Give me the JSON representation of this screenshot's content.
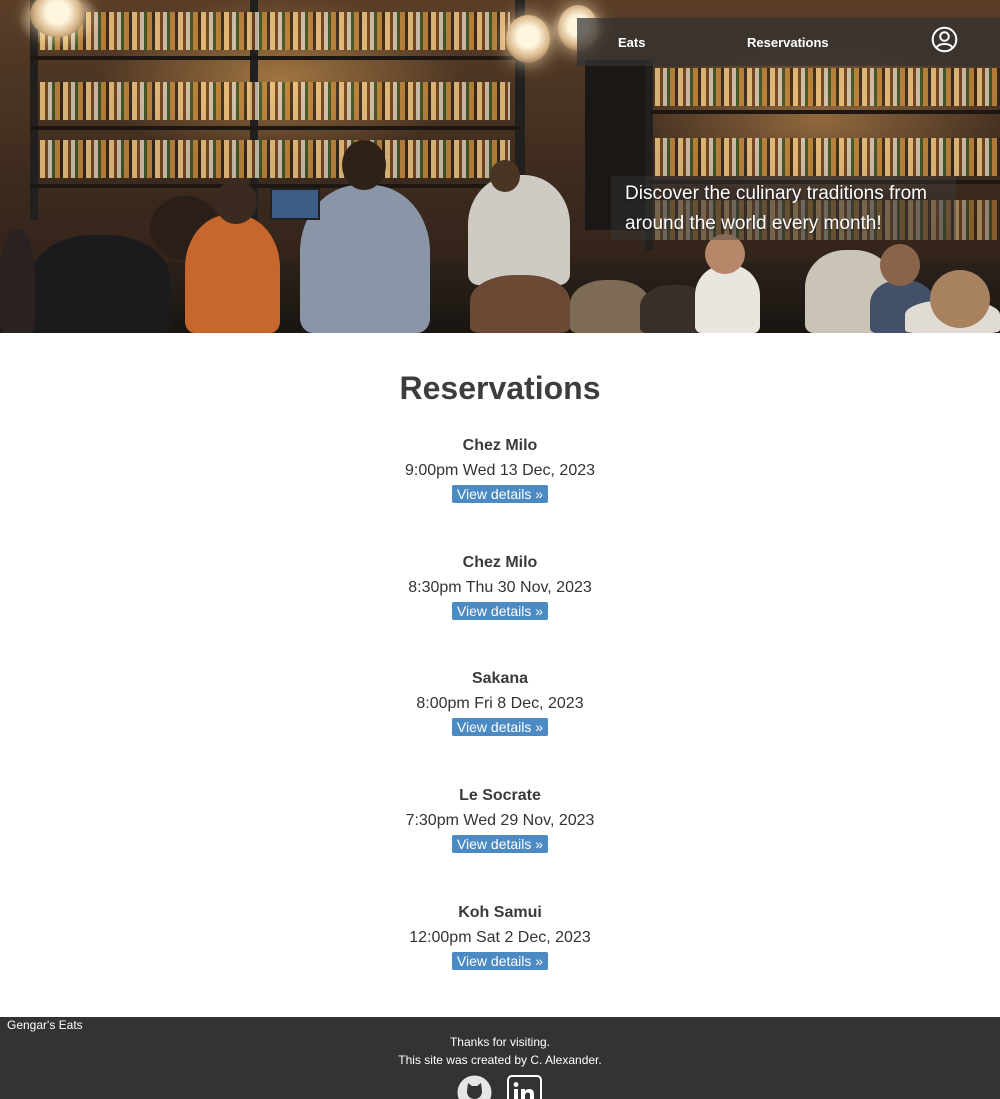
{
  "nav": {
    "items": [
      {
        "label": "Eats"
      },
      {
        "label": "Reservations"
      }
    ],
    "account_icon": "user-circle-icon"
  },
  "hero": {
    "tagline": "Discover the culinary traditions from around the world every month!"
  },
  "main": {
    "title": "Reservations",
    "reservations": [
      {
        "name": "Chez Milo",
        "datetime": "9:00pm Wed 13 Dec, 2023",
        "button": "View details »"
      },
      {
        "name": "Chez Milo",
        "datetime": "8:30pm Thu 30 Nov, 2023",
        "button": "View details »"
      },
      {
        "name": "Sakana",
        "datetime": "8:00pm Fri 8 Dec, 2023",
        "button": "View details »"
      },
      {
        "name": "Le Socrate",
        "datetime": "7:30pm Wed 29 Nov, 2023",
        "button": "View details »"
      },
      {
        "name": "Koh Samui",
        "datetime": "12:00pm Sat 2 Dec, 2023",
        "button": "View details »"
      }
    ]
  },
  "footer": {
    "brand": "Gengar's Eats",
    "thanks": "Thanks for visiting.",
    "credit": "This site was created by C. Alexander.",
    "social_icons": [
      "github-icon",
      "linkedin-icon"
    ]
  },
  "colors": {
    "button": "#4b8ac3",
    "footer_bg": "#333333",
    "title_text": "#3d3d3d"
  }
}
